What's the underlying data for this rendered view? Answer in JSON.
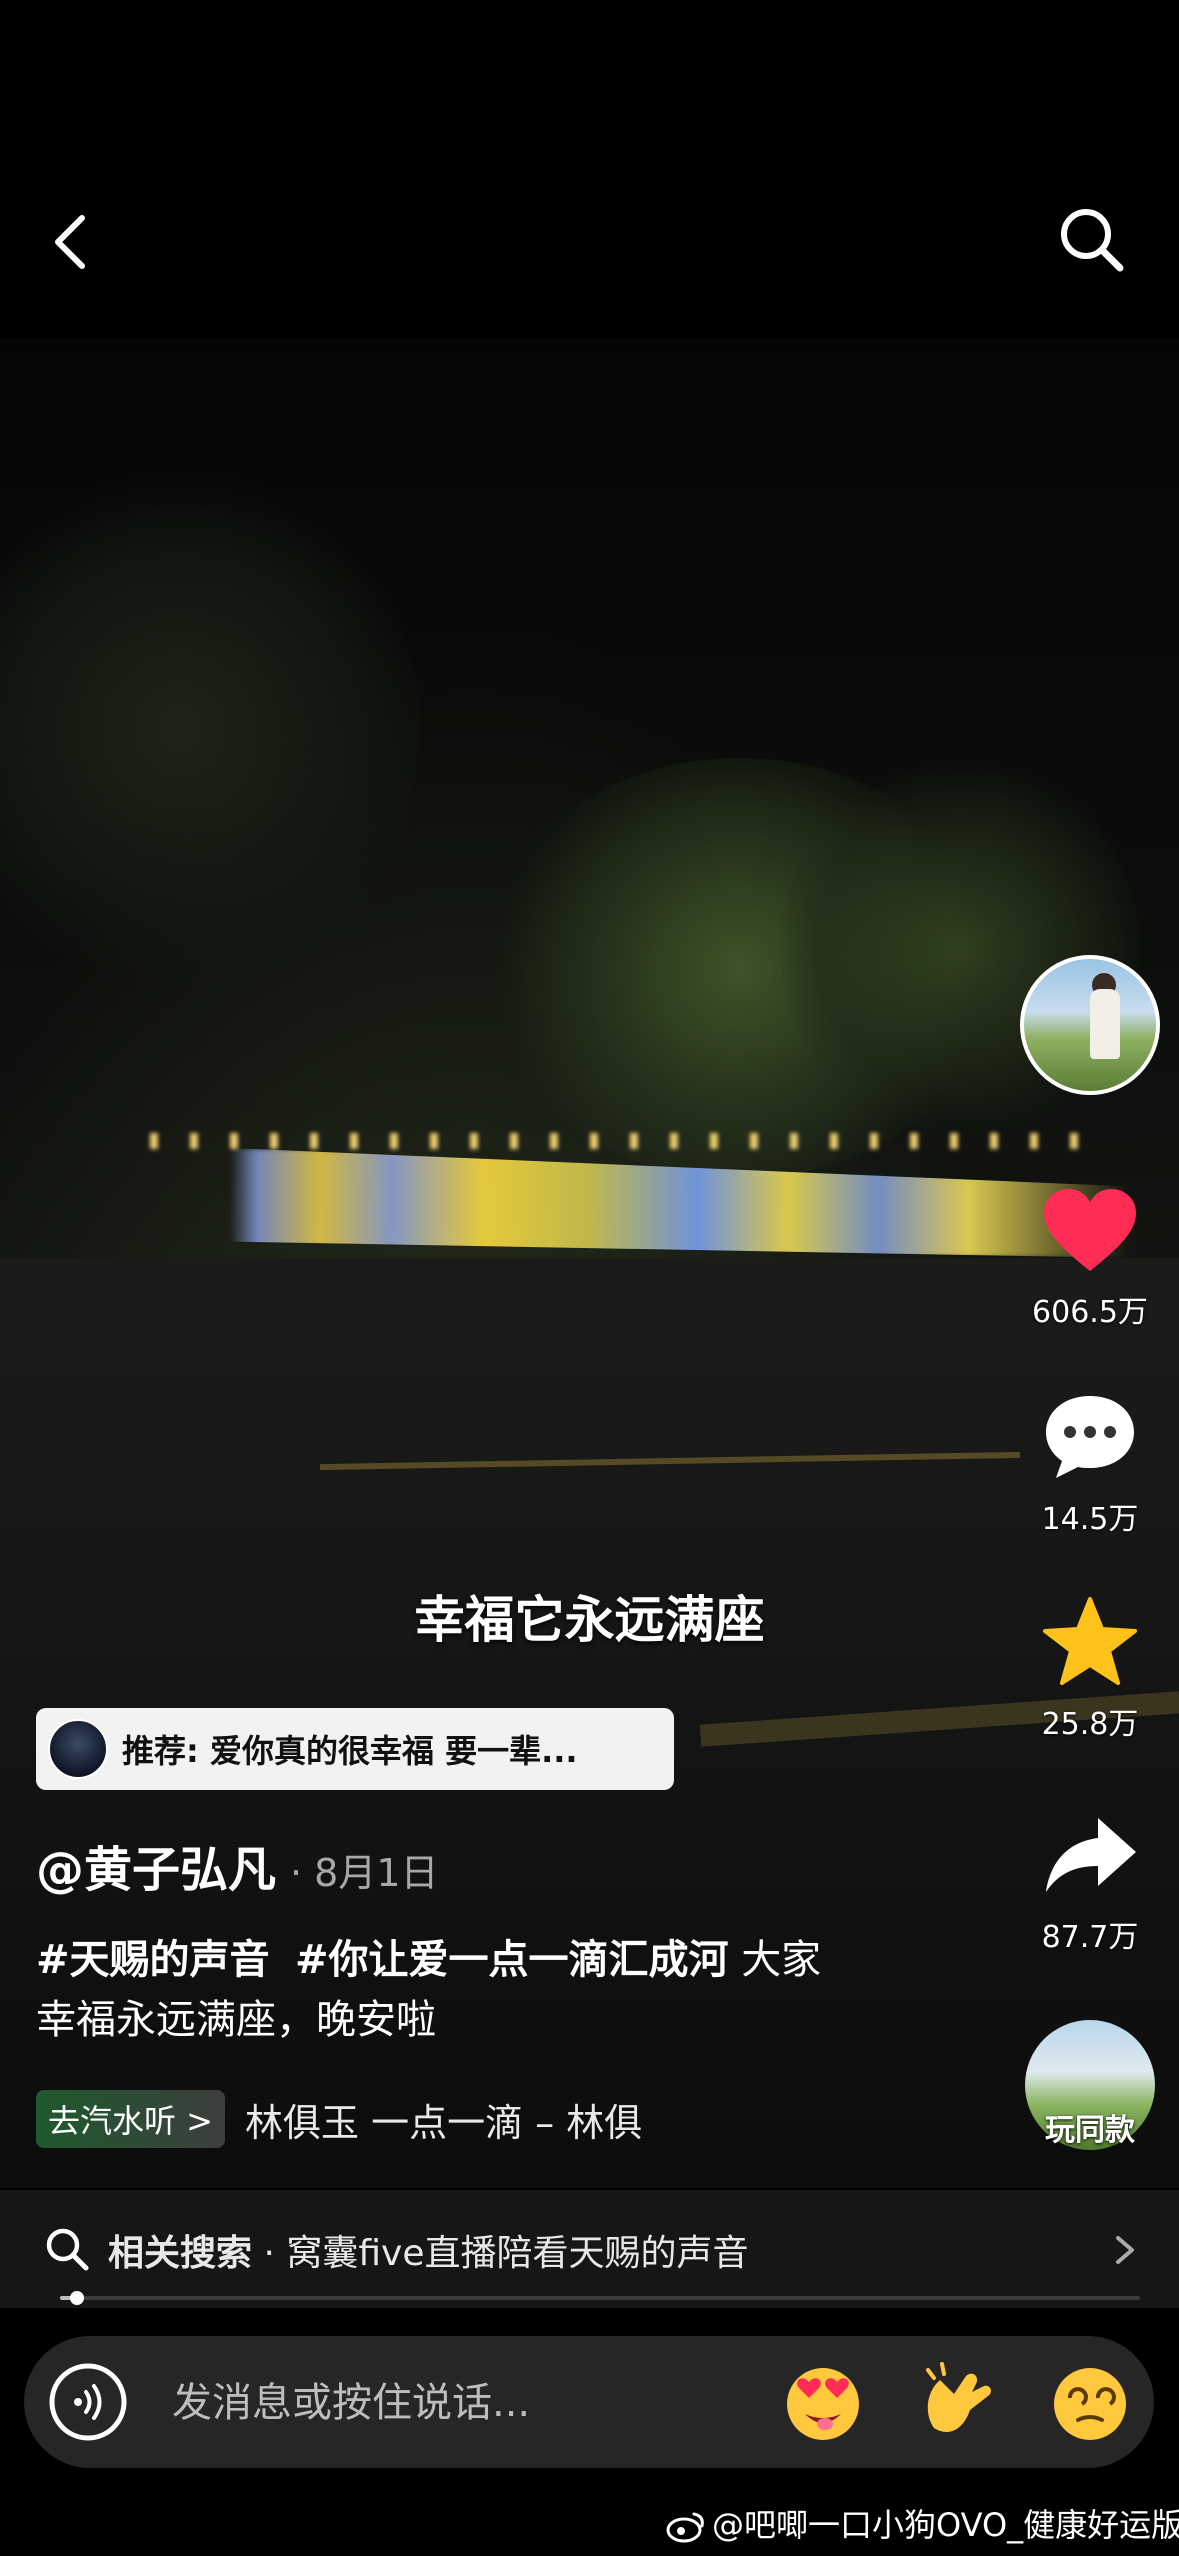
{
  "topbar": {
    "back_icon": "chevron-left-icon",
    "search_icon": "search-icon"
  },
  "video": {
    "subtitle": "幸福它永远满座"
  },
  "rail": {
    "likes": "606.5万",
    "comments": "14.5万",
    "favorites": "25.8万",
    "shares": "87.7万",
    "like_color": "#ff2d55",
    "favorite_color": "#ffc21a",
    "remix_label": "玩同款"
  },
  "recommend": {
    "text": "推荐: 爱你真的很幸福 要一辈..."
  },
  "post": {
    "author": "@黄子弘凡",
    "date": "· 8月1日",
    "hashtag1": "#天赐的声音",
    "hashtag2": "#你让爱一点一滴汇成河",
    "caption_rest_line1": "大家",
    "caption_line2": "幸福永远满座，晚安啦"
  },
  "music": {
    "button_label": "去汽水听 >",
    "track": "林俱玉   一点一滴  –  林俱"
  },
  "related": {
    "label": "相关搜索",
    "separator": "·",
    "query": "窝囊five直播陪看天赐的声音"
  },
  "progress": {
    "fraction": 0.016
  },
  "message_bar": {
    "placeholder": "发消息或按住说话..."
  },
  "watermark": {
    "text": "@吧唧一口小狗OVO_健康好运版"
  }
}
